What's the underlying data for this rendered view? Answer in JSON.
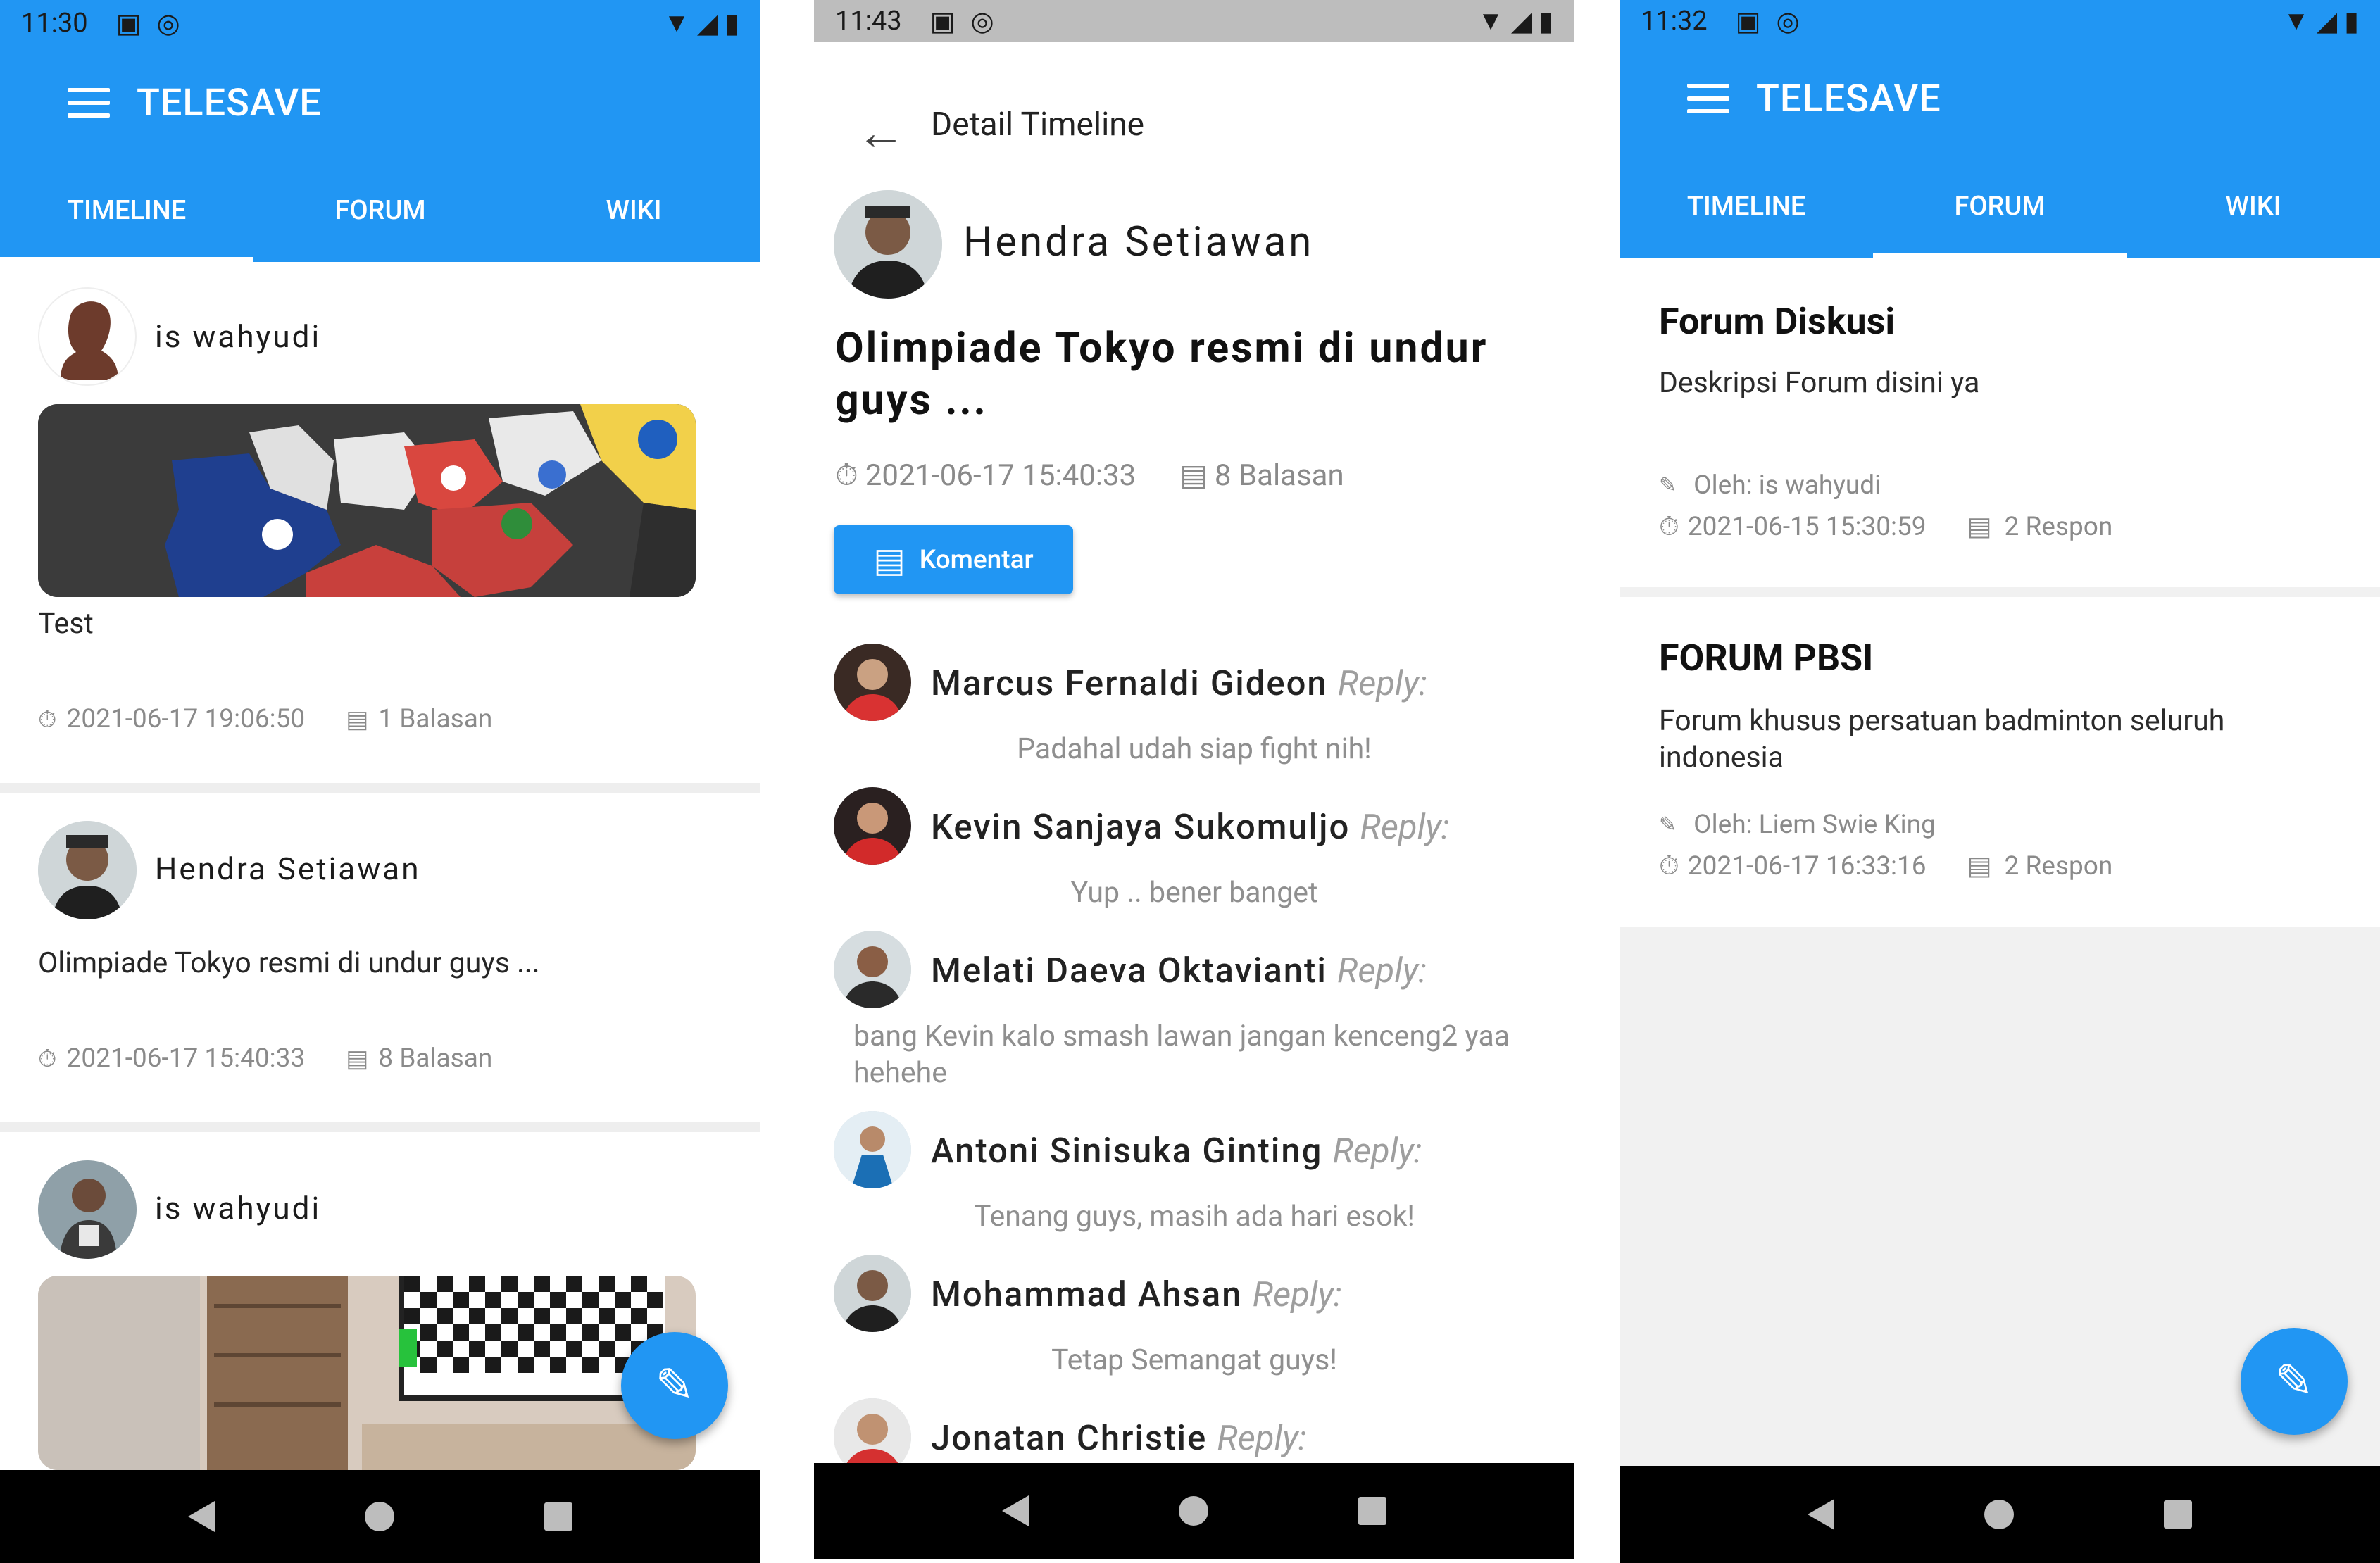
{
  "panel1": {
    "status": {
      "time": "11:30"
    },
    "appbar": {
      "title": "TELESAVE"
    },
    "tabs": [
      {
        "label": "TIMELINE"
      },
      {
        "label": "FORUM"
      },
      {
        "label": "WIKI"
      }
    ],
    "active_tab": "TIMELINE",
    "posts": [
      {
        "author": "is wahyudi",
        "text": "Test",
        "time": "2021-06-17 19:06:50",
        "replies": "1 Balasan"
      },
      {
        "author": "Hendra Setiawan",
        "text": "Olimpiade Tokyo resmi di undur guys ...",
        "time": "2021-06-17 15:40:33",
        "replies": "8 Balasan"
      },
      {
        "author": "is wahyudi"
      }
    ]
  },
  "panel2": {
    "status": {
      "time": "11:43"
    },
    "header": {
      "title": "Detail Timeline"
    },
    "author": "Hendra Setiawan",
    "heading": "Olimpiade Tokyo resmi di undur guys ...",
    "time": "2021-06-17 15:40:33",
    "replies": "8 Balasan",
    "comment_button": "Komentar",
    "reply_label": "Reply:",
    "comments": [
      {
        "name": "Marcus Fernaldi Gideon",
        "text": "Padahal udah siap fight nih!"
      },
      {
        "name": "Kevin Sanjaya Sukomuljo",
        "text": "Yup .. bener banget"
      },
      {
        "name": "Melati Daeva Oktavianti",
        "text": "bang Kevin kalo smash lawan jangan kenceng2 yaa hehehe"
      },
      {
        "name": "Antoni Sinisuka Ginting",
        "text": "Tenang guys, masih ada hari esok!"
      },
      {
        "name": "Mohammad Ahsan",
        "text": "Tetap Semangat guys!"
      },
      {
        "name": "Jonatan Christie",
        "text": ""
      }
    ]
  },
  "panel3": {
    "status": {
      "time": "11:32"
    },
    "appbar": {
      "title": "TELESAVE"
    },
    "tabs": [
      {
        "label": "TIMELINE"
      },
      {
        "label": "FORUM"
      },
      {
        "label": "WIKI"
      }
    ],
    "active_tab": "FORUM",
    "forums": [
      {
        "title": "Forum Diskusi",
        "desc": "Deskripsi Forum disini ya",
        "by": "Oleh: is wahyudi",
        "time": "2021-06-15 15:30:59",
        "resp": "2 Respon"
      },
      {
        "title": "FORUM PBSI",
        "desc": "Forum khusus persatuan badminton seluruh indonesia",
        "by": "Oleh: Liem Swie King",
        "time": "2021-06-17 16:33:16",
        "resp": "2 Respon"
      }
    ]
  },
  "colors": {
    "primary": "#2196f3",
    "divider": "#eeeeee",
    "meta": "#8a8a8a"
  },
  "icons": {
    "menu": "menu-icon",
    "edit": "edit-icon",
    "clock": "clock-icon",
    "comment": "comment-icon",
    "back": "back-arrow-icon"
  }
}
